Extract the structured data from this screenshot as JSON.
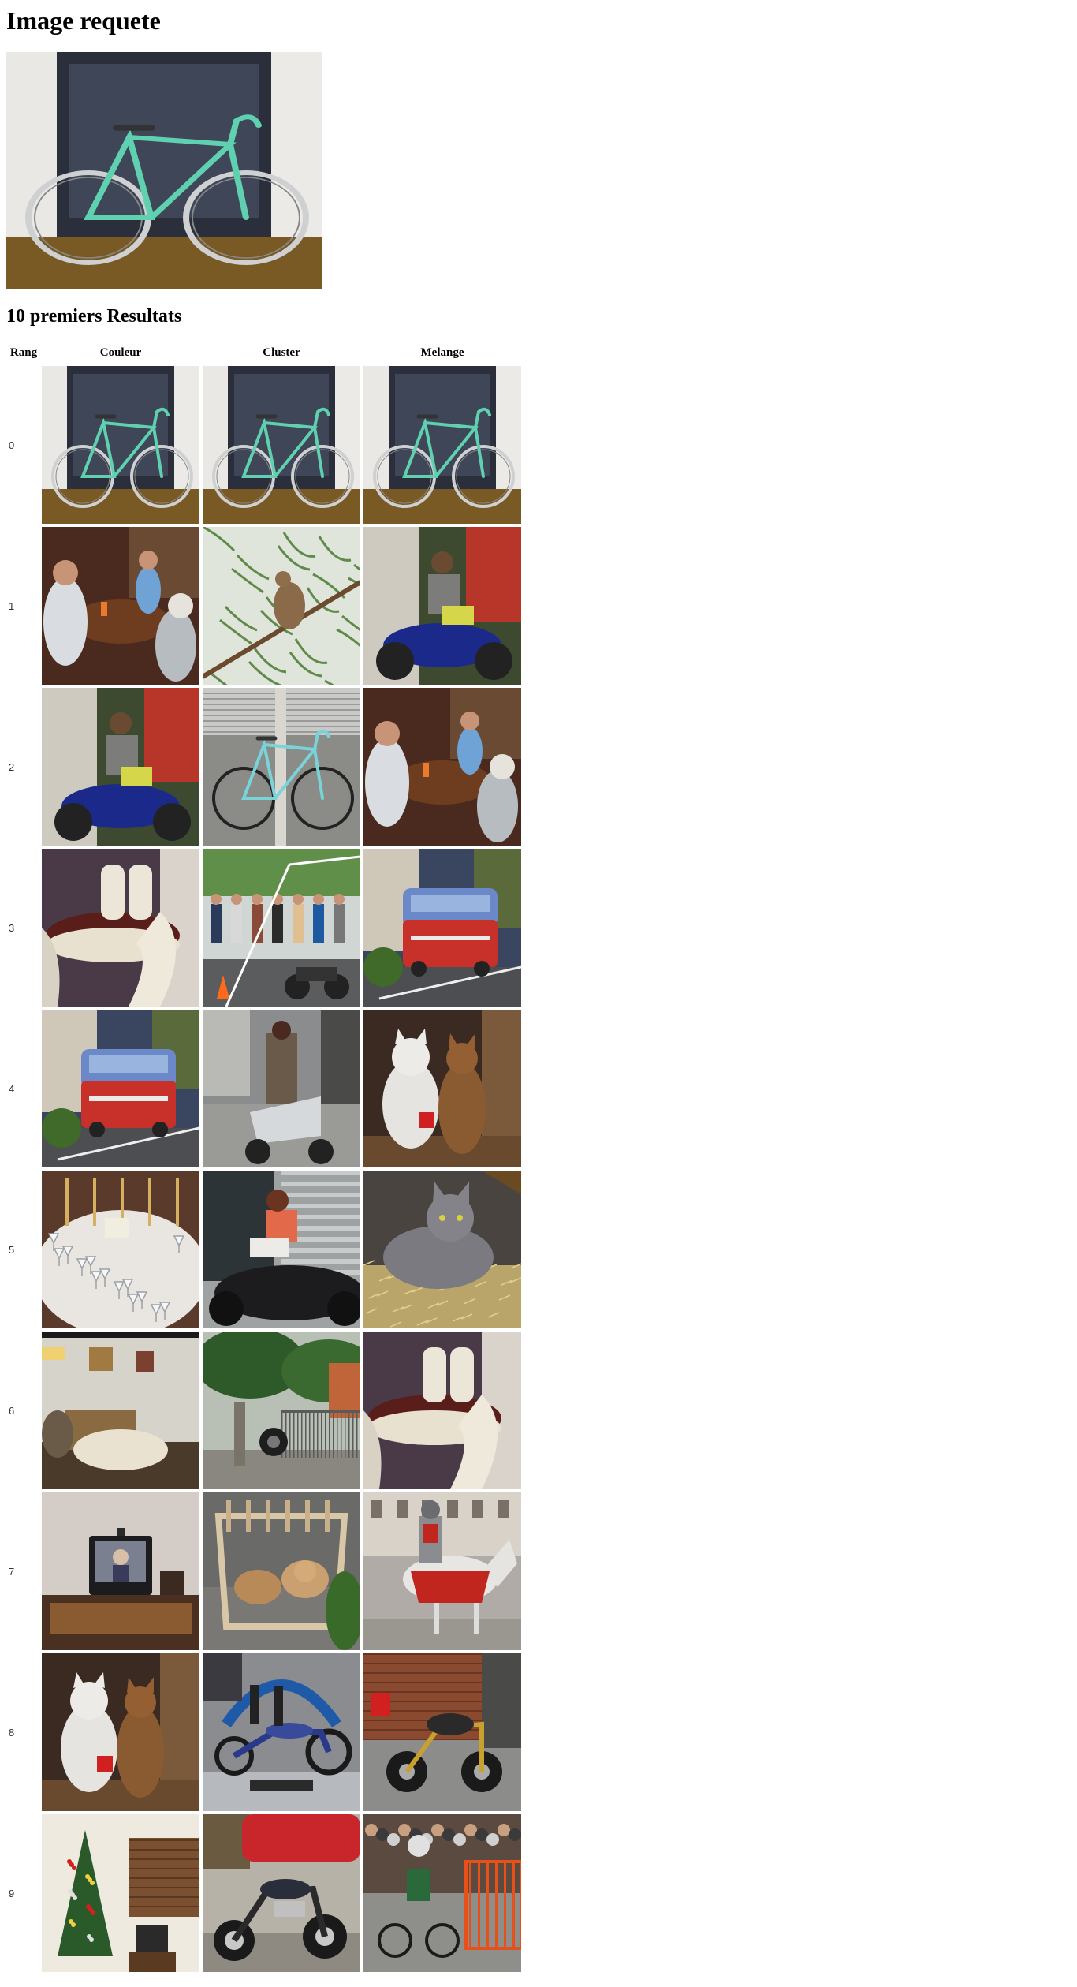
{
  "page": {
    "title": "Image requete",
    "results_title": "10 premiers Resultats"
  },
  "table": {
    "headers": {
      "rank": "Rang",
      "color": "Couleur",
      "cluster": "Cluster",
      "mix": "Melange"
    },
    "rows": [
      {
        "rank": "0",
        "color": "bicycle-mint",
        "cluster": "bicycle-mint",
        "mix": "bicycle-mint"
      },
      {
        "rank": "1",
        "color": "people-table",
        "cluster": "bird-tree",
        "mix": "motorbike-rider"
      },
      {
        "rank": "2",
        "color": "motorbike-rider",
        "cluster": "bicycle-street",
        "mix": "people-table"
      },
      {
        "rank": "3",
        "color": "dining-room",
        "cluster": "motorcycle-crowd",
        "mix": "red-bus"
      },
      {
        "rank": "4",
        "color": "red-bus",
        "cluster": "scooter-woman",
        "mix": "cats-pair"
      },
      {
        "rank": "5",
        "color": "table-glasses",
        "cluster": "woman-motorcycle",
        "mix": "gray-cat-hay"
      },
      {
        "rank": "6",
        "color": "living-room",
        "cluster": "garden-fence",
        "mix": "dining-room"
      },
      {
        "rank": "7",
        "color": "tv-room",
        "cluster": "cat-basket",
        "mix": "knight-horse"
      },
      {
        "rank": "8",
        "color": "cats-pair",
        "cluster": "chopper-show",
        "mix": "street-motorbike"
      },
      {
        "rank": "9",
        "color": "christmas-tree",
        "cluster": "cruiser-bike",
        "mix": "cyclist-race"
      }
    ]
  }
}
